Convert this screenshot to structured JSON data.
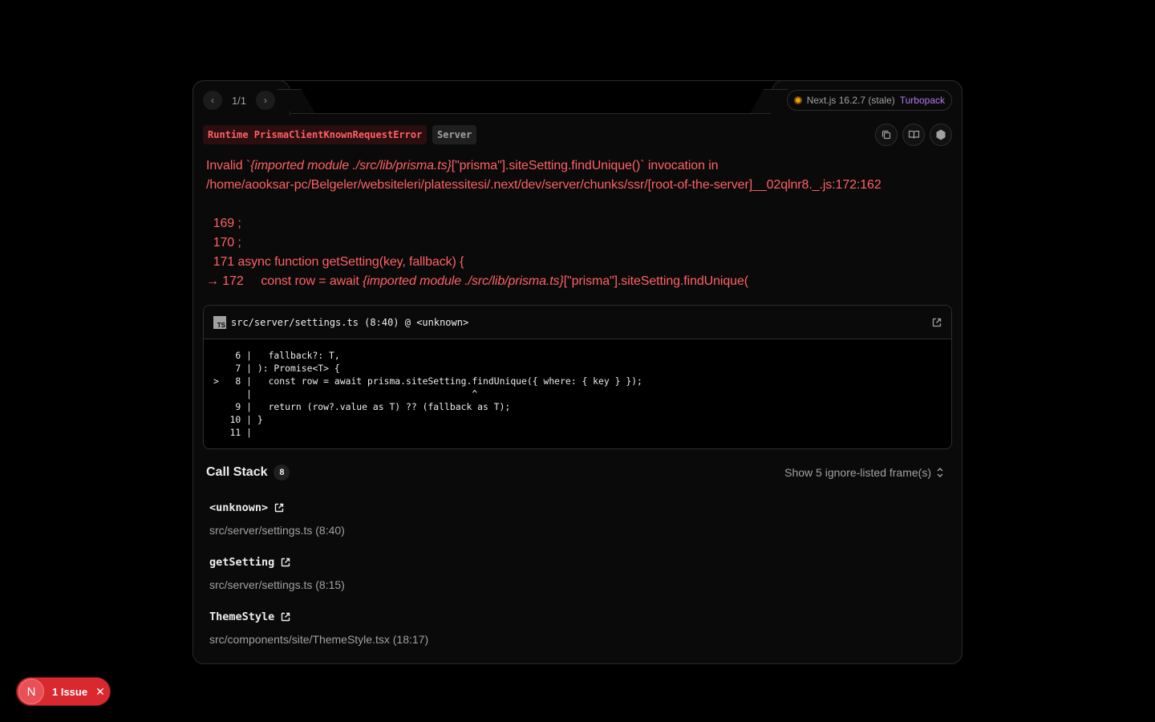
{
  "pager": {
    "count": "1/1",
    "prev_icon": "chevron-left-icon",
    "next_icon": "chevron-right-icon"
  },
  "version": {
    "label": "Next.js 16.2.7 (stale)",
    "bundler": "Turbopack",
    "status_color": "#f59e0b"
  },
  "header": {
    "error_badge": "Runtime PrismaClientKnownRequestError",
    "env_badge": "Server",
    "actions": [
      "copy-icon",
      "docs-icon",
      "nodejs-icon"
    ]
  },
  "message": {
    "line1_a": "Invalid `",
    "line1_b": "{imported module ./src/lib/prisma.ts}",
    "line1_c": "[\"prisma\"].siteSetting.findUnique()` invocation in",
    "line2": "/home/aooksar-pc/Belgeler/websiteleri/platessitesi/.next/dev/server/chunks/ssr/[root-of-the-server]__02qlnr8._.js:172:162",
    "line4": "  169 ;",
    "line5": "  170 ;",
    "line6": "  171 async function getSetting(key, fallback) {",
    "line7_a": "→ 172     const row = await ",
    "line7_b": "{imported module ./src/lib/prisma.ts}",
    "line7_c": "[\"prisma\"].siteSetting.findUnique("
  },
  "codeframe": {
    "file": "src/server/settings.ts (8:40) @ <unknown>",
    "lines": [
      "    6 |   fallback?: T,",
      "    7 | ): Promise<T> {",
      ">   8 |   const row = await prisma.siteSetting.findUnique({ where: { key } });",
      "      |                                        ^",
      "    9 |   return (row?.value as T) ?? (fallback as T);",
      "   10 | }",
      "   11 |"
    ]
  },
  "callstack": {
    "title": "Call Stack",
    "count": "8",
    "toggle": "Show 5 ignore-listed frame(s)",
    "frames": [
      {
        "name": "<unknown>",
        "loc": "src/server/settings.ts (8:40)"
      },
      {
        "name": "getSetting",
        "loc": "src/server/settings.ts (8:15)"
      },
      {
        "name": "ThemeStyle",
        "loc": "src/components/site/ThemeStyle.tsx (18:17)"
      }
    ]
  },
  "issues": {
    "logo": "N",
    "label": "1 Issue"
  }
}
